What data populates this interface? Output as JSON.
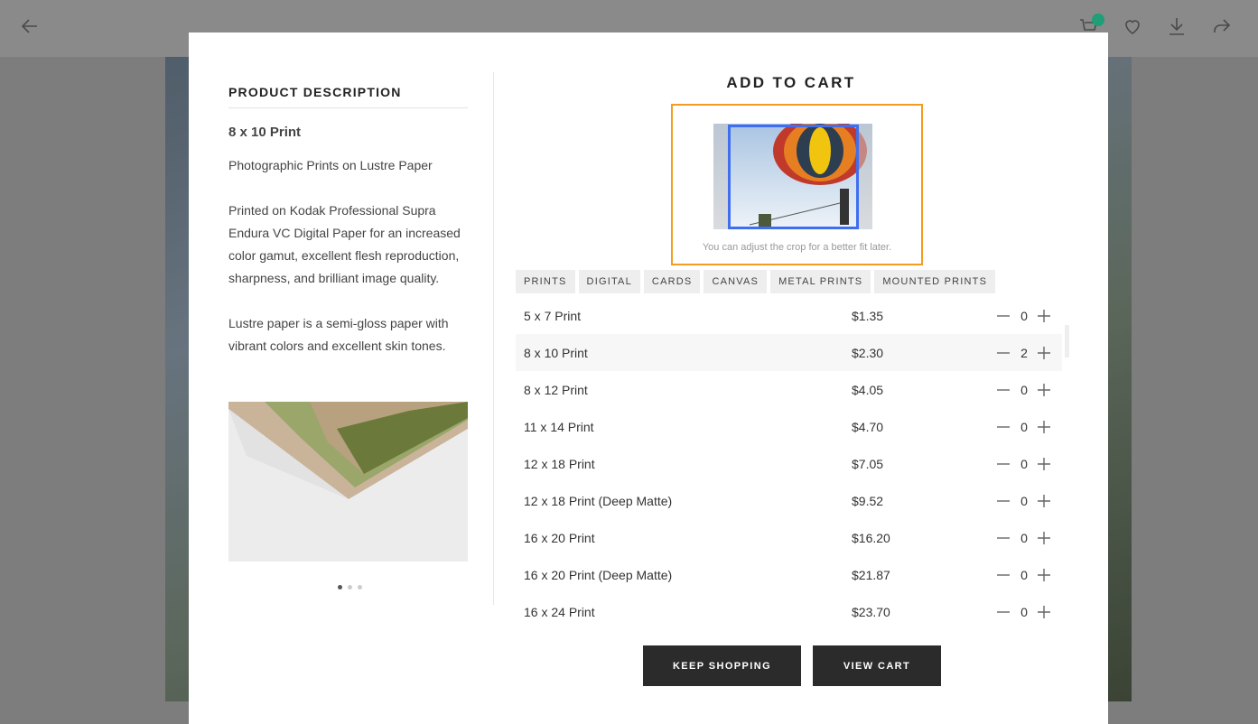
{
  "background": {
    "icons": [
      "back-arrow-icon",
      "cart-icon",
      "heart-icon",
      "download-icon",
      "share-icon"
    ],
    "cart_badge_color": "#1f9e77"
  },
  "description": {
    "heading": "PRODUCT DESCRIPTION",
    "title": "8 x 10 Print",
    "subtitle": "Photographic Prints on Lustre Paper",
    "paragraph_1": "Printed on Kodak Professional Supra Endura VC Digital Paper for an increased color gamut, excellent flesh reproduction, sharpness, and brilliant image quality.",
    "paragraph_2": "Lustre paper is a semi-gloss paper with vibrant colors and excellent skin tones.",
    "carousel_count": 3,
    "carousel_active": 1
  },
  "cart": {
    "title": "ADD TO CART",
    "crop_hint": "You can adjust the crop for a better fit later.",
    "tabs": [
      "PRINTS",
      "DIGITAL",
      "CARDS",
      "CANVAS",
      "METAL PRINTS",
      "MOUNTED PRINTS"
    ],
    "items": [
      {
        "name": "5 x 7 Print",
        "price": "$1.35",
        "qty": "0"
      },
      {
        "name": "8 x 10 Print",
        "price": "$2.30",
        "qty": "2"
      },
      {
        "name": "8 x 12 Print",
        "price": "$4.05",
        "qty": "0"
      },
      {
        "name": "11 x 14 Print",
        "price": "$4.70",
        "qty": "0"
      },
      {
        "name": "12 x 18 Print",
        "price": "$7.05",
        "qty": "0"
      },
      {
        "name": "12 x 18 Print (Deep Matte)",
        "price": "$9.52",
        "qty": "0"
      },
      {
        "name": "16 x 20 Print",
        "price": "$16.20",
        "qty": "0"
      },
      {
        "name": "16 x 20 Print (Deep Matte)",
        "price": "$21.87",
        "qty": "0"
      },
      {
        "name": "16 x 24 Print",
        "price": "$23.70",
        "qty": "0"
      }
    ],
    "keep_shopping_label": "KEEP SHOPPING",
    "view_cart_label": "VIEW CART",
    "accent_crop_border": "#f39c1f",
    "accent_crop_frame": "#3f6ff0"
  }
}
